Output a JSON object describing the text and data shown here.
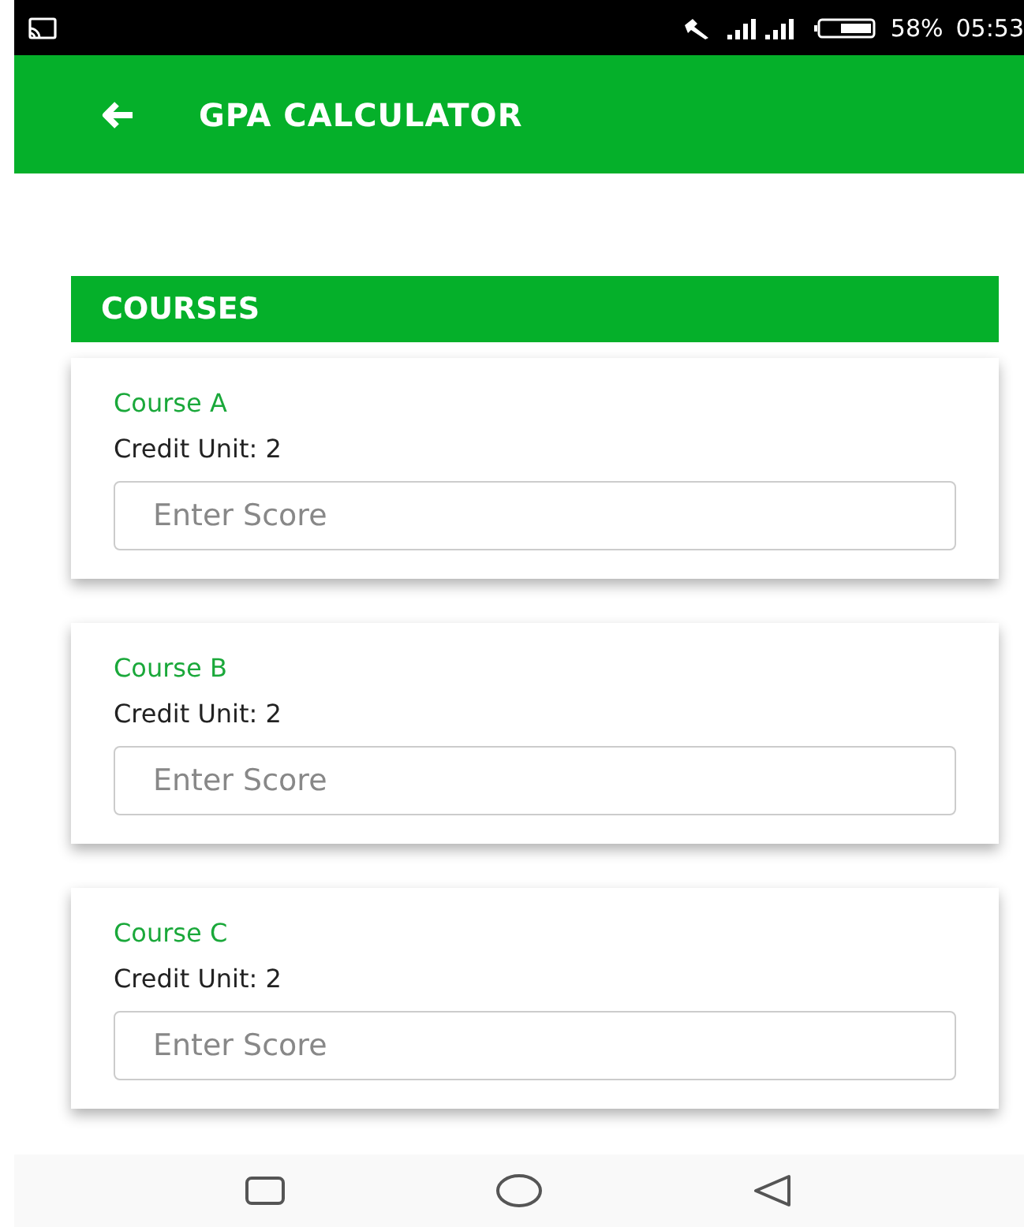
{
  "status_bar": {
    "battery": "58%",
    "time": "05:53"
  },
  "app_bar": {
    "title": "GPA CALCULATOR"
  },
  "section": {
    "title": "COURSES"
  },
  "courses": [
    {
      "name": "Course A",
      "credit": "Credit Unit: 2",
      "placeholder": "Enter Score"
    },
    {
      "name": "Course B",
      "credit": "Credit Unit: 2",
      "placeholder": "Enter Score"
    },
    {
      "name": "Course C",
      "credit": "Credit Unit: 2",
      "placeholder": "Enter Score"
    }
  ]
}
